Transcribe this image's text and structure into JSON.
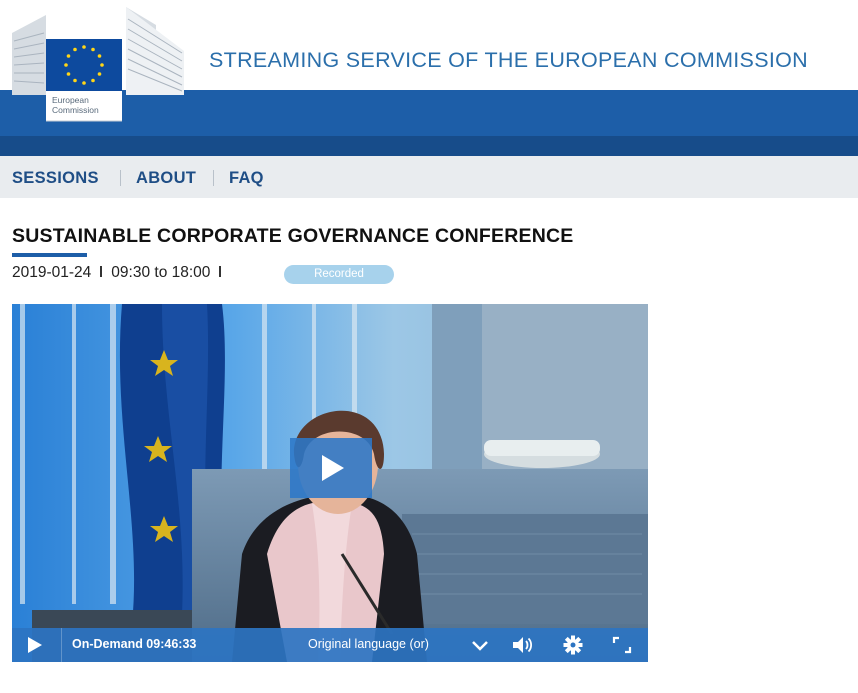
{
  "header": {
    "site_title": "STREAMING SERVICE OF THE EUROPEAN COMMISSION",
    "logo_line1": "European",
    "logo_line2": "Commission"
  },
  "nav": {
    "items": [
      {
        "label": "SESSIONS"
      },
      {
        "label": "ABOUT"
      },
      {
        "label": "FAQ"
      }
    ]
  },
  "event": {
    "title": "SUSTAINABLE CORPORATE GOVERNANCE CONFERENCE",
    "date": "2019-01-24",
    "time": "09:30 to 18:00",
    "status": "Recorded"
  },
  "player": {
    "mode_label": "On-Demand 09:46:33",
    "language_label": "Original language (or)",
    "icons": [
      "play-icon",
      "chevron-down-icon",
      "volume-icon",
      "gear-icon",
      "fullscreen-icon"
    ]
  },
  "colors": {
    "brand_blue": "#1d5ea8",
    "nav_text": "#1f4e86",
    "badge": "#a7d2ec",
    "title_blue": "#2b6fab"
  }
}
